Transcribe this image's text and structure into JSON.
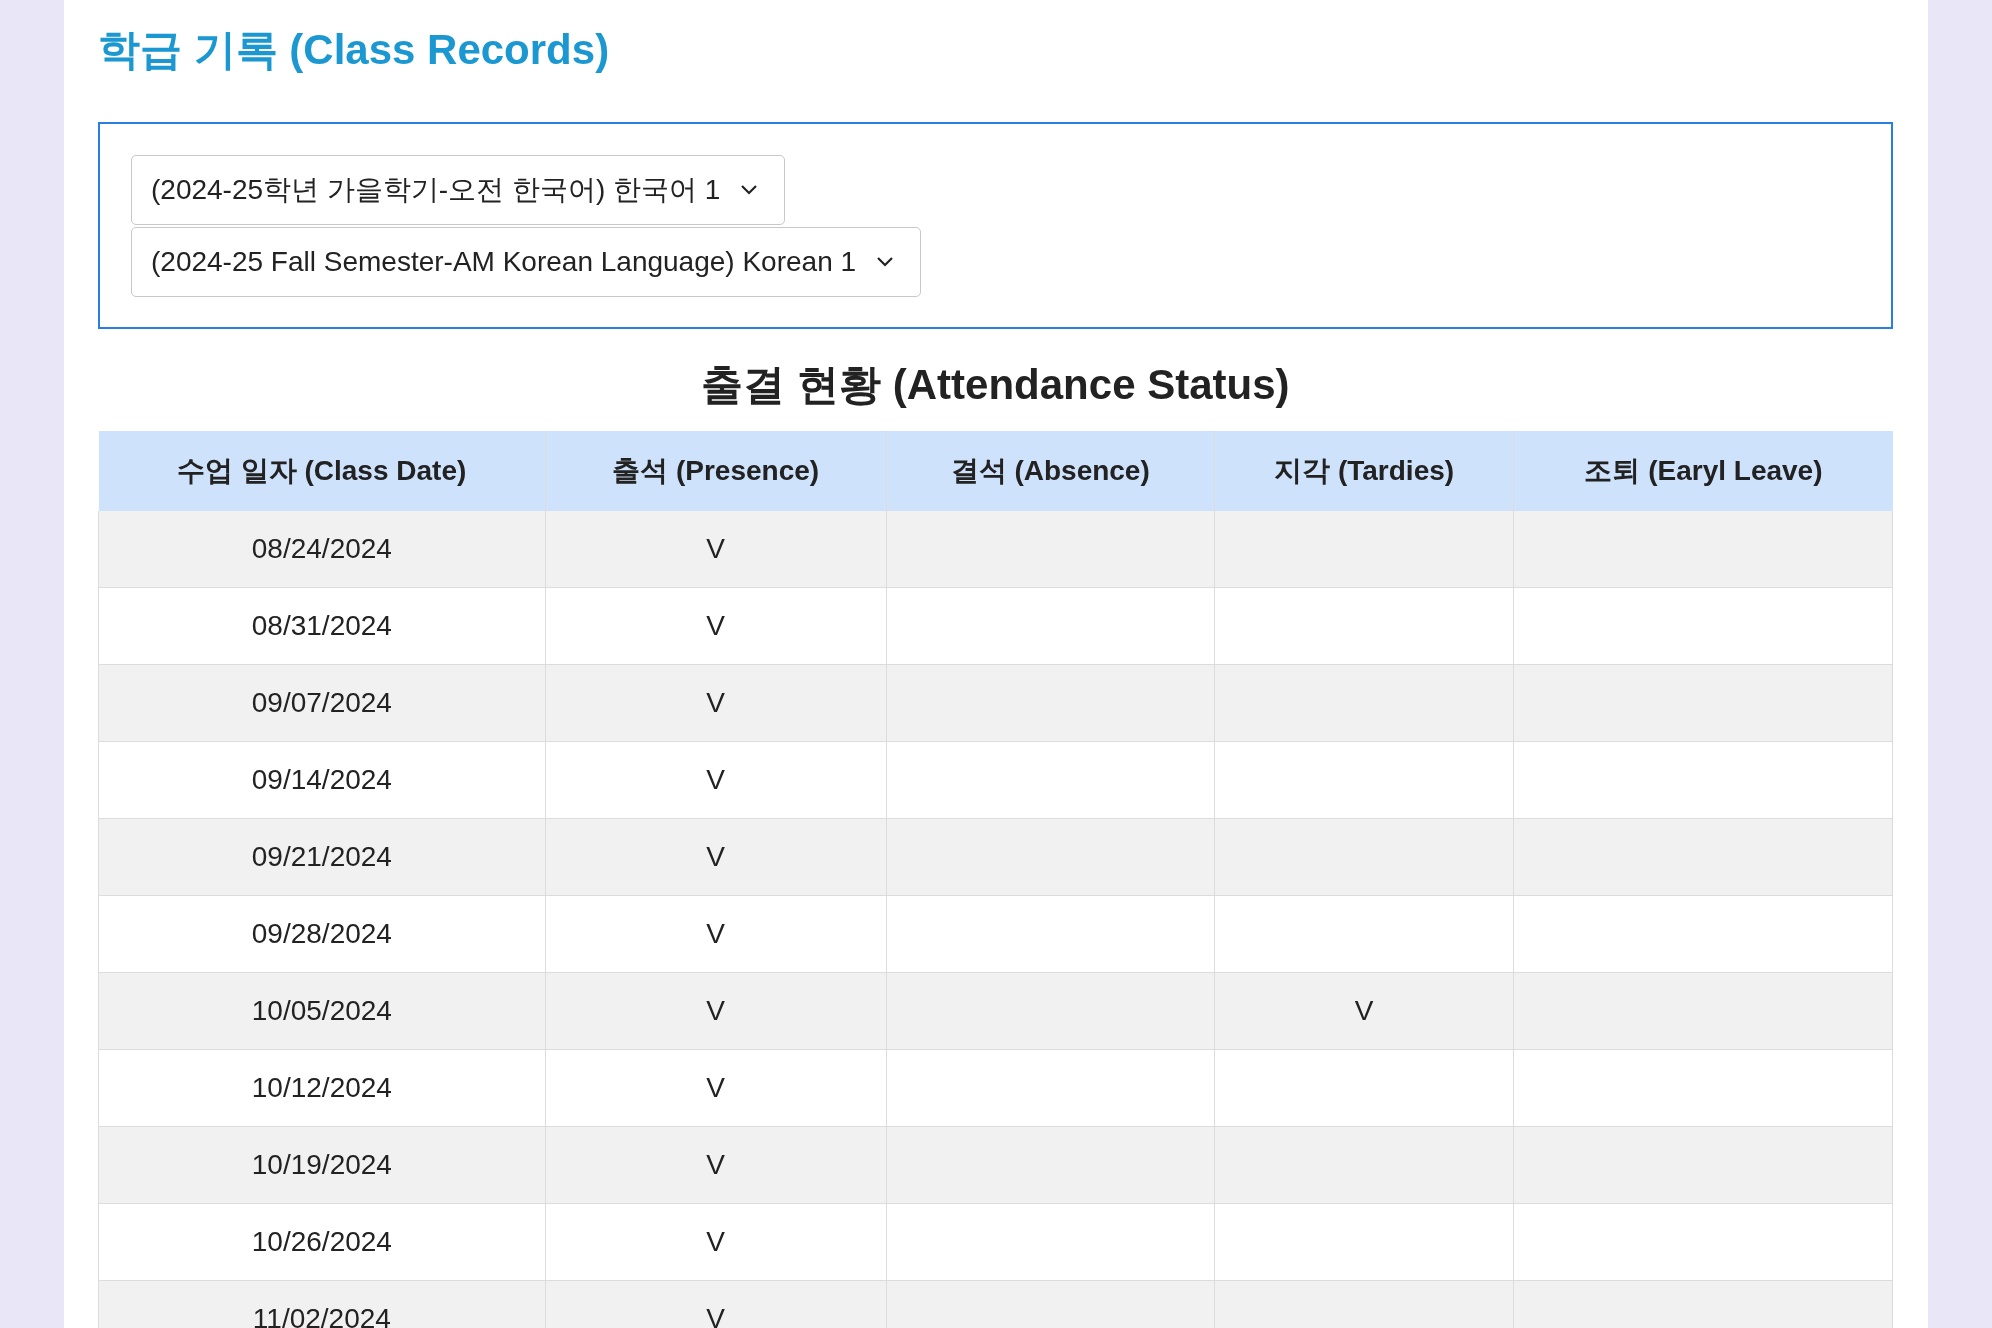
{
  "title": "학급 기록 (Class Records)",
  "selects": [
    {
      "value": "(2024-25학년 가을학기-오전 한국어) 한국어 1"
    },
    {
      "value": "(2024-25 Fall Semester-AM Korean Language) Korean 1"
    }
  ],
  "attendance": {
    "heading": "출결 현황 (Attendance Status)",
    "columns": [
      "수업 일자 (Class Date)",
      "출석 (Presence)",
      "결석 (Absence)",
      "지각 (Tardies)",
      "조퇴 (Earyl Leave)"
    ],
    "rows": [
      {
        "date": "08/24/2024",
        "presence": "V"
      },
      {
        "date": "08/31/2024",
        "presence": "V"
      },
      {
        "date": "09/07/2024",
        "presence": "V"
      },
      {
        "date": "09/14/2024",
        "presence": "V"
      },
      {
        "date": "09/21/2024",
        "presence": "V"
      },
      {
        "date": "09/28/2024",
        "presence": "V"
      },
      {
        "date": "10/05/2024",
        "presence": "V",
        "tardies": "V"
      },
      {
        "date": "10/12/2024",
        "presence": "V"
      },
      {
        "date": "10/19/2024",
        "presence": "V"
      },
      {
        "date": "10/26/2024",
        "presence": "V"
      },
      {
        "date": "11/02/2024",
        "presence": "V"
      }
    ]
  }
}
